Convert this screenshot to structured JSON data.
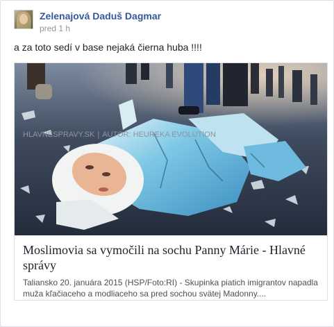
{
  "post": {
    "author": "Zelenajová Daduš Dagmar",
    "time": "pred 1 h",
    "message": "a za toto sedí v base nejaká čierna huba !!!!"
  },
  "link_card": {
    "title": "Moslimovia sa vymočili na sochu Panny Márie - Hlavné správy",
    "description": "Taliansko 20. januára 2015 (HSP/Foto:RI) - Skupinka piatich imigrantov napadla muža kľačiaceho a modliaceho sa pred sochou svätej Madonny....",
    "domain": "HLAVNESPRAVY.SK",
    "separator": "|",
    "author_credit": "AUTOR: HEUREKA EVOLUTION"
  },
  "colors": {
    "author_link": "#365899",
    "secondary_text": "#90949c",
    "statue_blue": "#5fb6dc"
  }
}
